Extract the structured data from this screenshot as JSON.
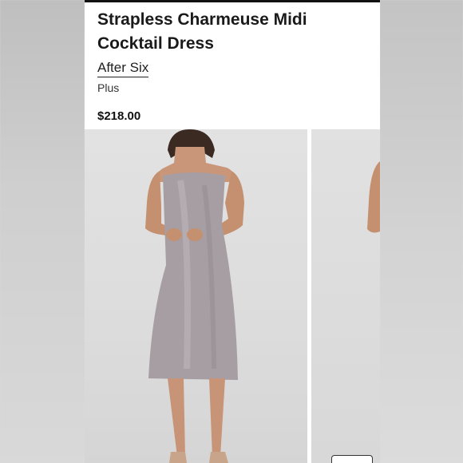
{
  "product": {
    "title": "Strapless Charmeuse Midi Cocktail Dress",
    "brand": "After Six",
    "size_type": "Plus",
    "price": "$218.00"
  },
  "gallery": {
    "main_image": "model-wearing-dress-photo",
    "next_image": "model-side-photo-partial"
  },
  "colors": {
    "dress": "#a89ea3",
    "background": "#dcdcdc",
    "panel": "#ffffff",
    "text": "#1a1a1a"
  }
}
